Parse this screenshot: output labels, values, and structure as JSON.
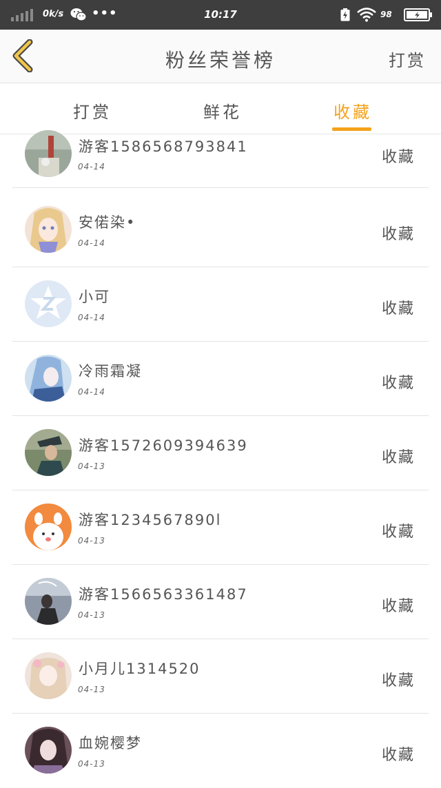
{
  "status_bar": {
    "speed": "0k/s",
    "dots": "•••",
    "time": "10:17",
    "battery_percent": "98"
  },
  "header": {
    "title": "粉丝荣誉榜",
    "action_label": "打赏",
    "back_icon": "chevron-left-icon"
  },
  "tabs": [
    {
      "label": "打赏",
      "active": false
    },
    {
      "label": "鲜花",
      "active": false
    },
    {
      "label": "收藏",
      "active": true
    }
  ],
  "colors": {
    "accent": "#f4a21b",
    "status_bar": "#3e3e3e",
    "text": "#555555"
  },
  "rows": [
    {
      "name": "游客1586568793841",
      "date": "04-14",
      "action": "收藏"
    },
    {
      "name": "安偌染•",
      "date": "04-14",
      "action": "收藏"
    },
    {
      "name": "小可",
      "date": "04-14",
      "action": "收藏"
    },
    {
      "name": "冷雨霜凝",
      "date": "04-14",
      "action": "收藏"
    },
    {
      "name": "游客1572609394639",
      "date": "04-13",
      "action": "收藏"
    },
    {
      "name": "游客1234567890l",
      "date": "04-13",
      "action": "收藏"
    },
    {
      "name": "游客1566563361487",
      "date": "04-13",
      "action": "收藏"
    },
    {
      "name": "小月儿1314520",
      "date": "04-13",
      "action": "收藏"
    },
    {
      "name": "血婉樱梦",
      "date": "04-13",
      "action": "收藏"
    }
  ]
}
